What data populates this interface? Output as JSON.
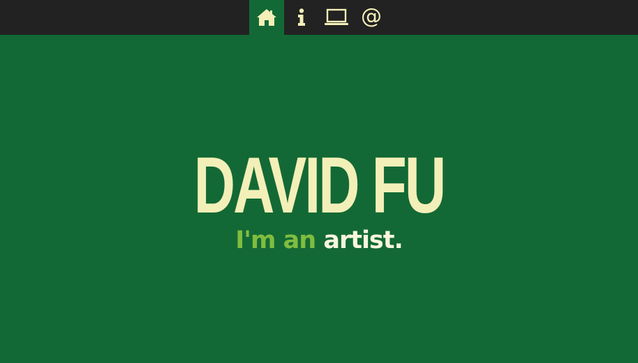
{
  "nav": {
    "items": [
      {
        "icon": "home-icon",
        "active": true
      },
      {
        "icon": "info-icon",
        "active": false
      },
      {
        "icon": "laptop-icon",
        "active": false
      },
      {
        "icon": "at-icon",
        "label": "@",
        "active": false
      }
    ]
  },
  "hero": {
    "name": "DAVID FU",
    "tagline_prefix": "I'm an",
    "tagline_word": "artist."
  },
  "colors": {
    "background": "#136935",
    "topbar": "#222222",
    "accent_text": "#f3efb8",
    "tag_prefix": "#80bd3f",
    "tag_word": "#f9f6dd"
  }
}
